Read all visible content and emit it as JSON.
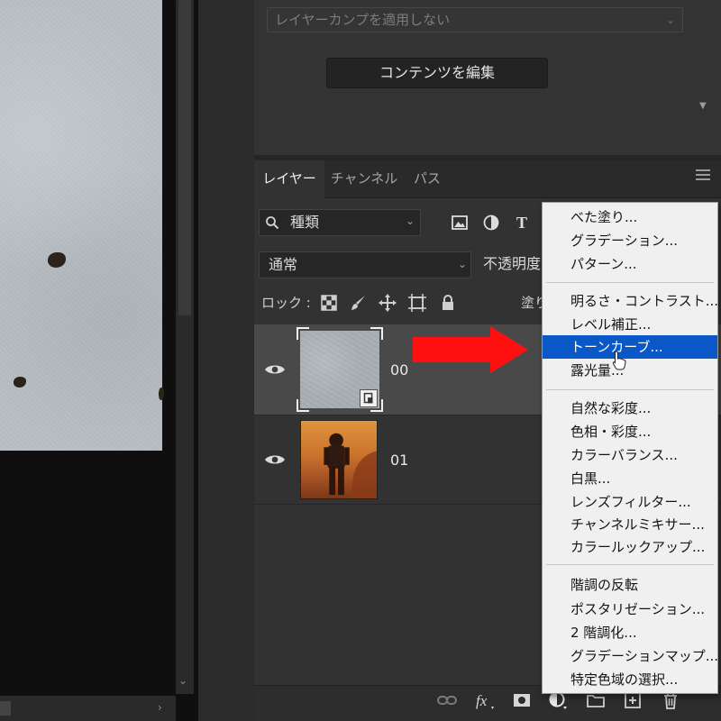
{
  "comps": {
    "select_value": "レイヤーカンプを適用しない",
    "edit_button": "コンテンツを編集"
  },
  "layers_panel": {
    "tabs": [
      "レイヤー",
      "チャンネル",
      "パス"
    ],
    "active_tab": "レイヤー",
    "filter": {
      "kind_label": "種類"
    },
    "blend_mode": "通常",
    "opacity_label": "不透明度",
    "lock_label": "ロック :",
    "fill_label": "塗り",
    "layers": [
      {
        "name": "00",
        "selected": true,
        "visible": true,
        "smart_object": true
      },
      {
        "name": "01",
        "selected": false,
        "visible": true,
        "smart_object": false
      }
    ]
  },
  "adjustment_menu": {
    "groups": [
      [
        "べた塗り...",
        "グラデーション...",
        "パターン..."
      ],
      [
        "明るさ・コントラスト...",
        "レベル補正...",
        "トーンカーブ...",
        "露光量..."
      ],
      [
        "自然な彩度...",
        "色相・彩度...",
        "カラーバランス...",
        "白黒...",
        "レンズフィルター...",
        "チャンネルミキサー...",
        "カラールックアップ..."
      ],
      [
        "階調の反転",
        "ポスタリゼーション...",
        "2 階調化...",
        "グラデーションマップ...",
        "特定色域の選択..."
      ]
    ],
    "highlighted": "トーンカーブ..."
  },
  "colors": {
    "menu_highlight": "#0a58c7",
    "annotation_arrow": "#ff1010",
    "panel_bg": "#323232",
    "selected_layer_bg": "#494949"
  }
}
